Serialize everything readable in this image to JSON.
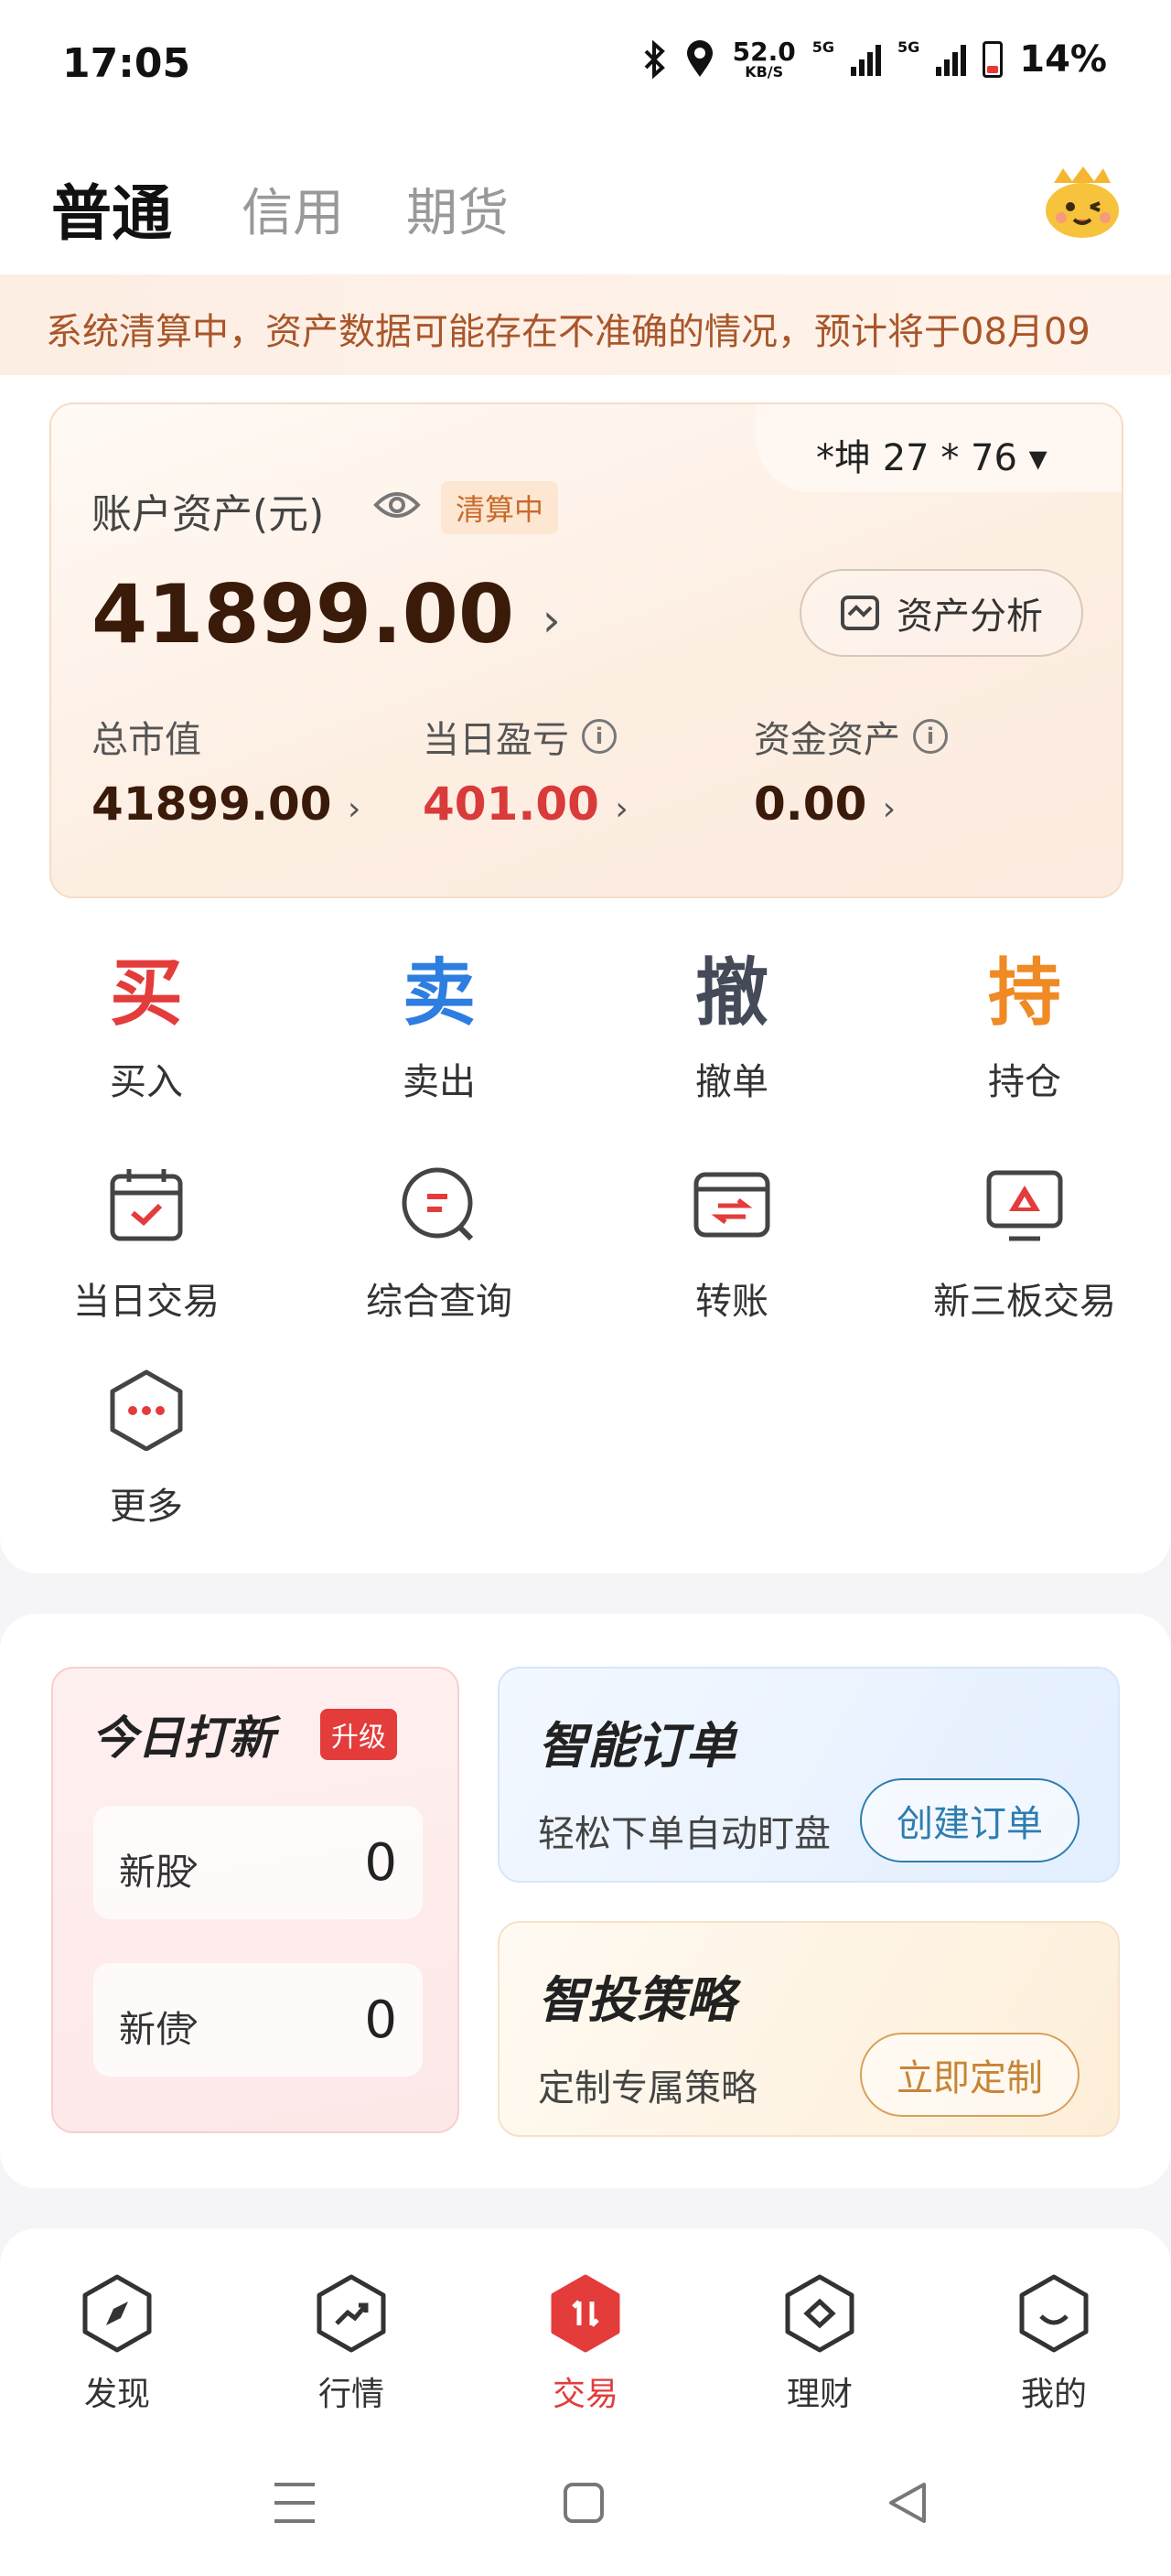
{
  "status_bar": {
    "time": "17:05",
    "net_speed": "52.0",
    "net_unit": "KB/S",
    "gen1": "5G",
    "gen2": "5G",
    "battery": "14%"
  },
  "top_tabs": [
    "普通",
    "信用",
    "期货"
  ],
  "ticker_text": "系统清算中，资产数据可能存在不准确的情况，预计将于08月09",
  "account": {
    "selector": "*坤 27 * 76 ▾",
    "label": "账户资产(元)",
    "clearing_badge": "清算中",
    "total": "41899.00",
    "analysis_button": "资产分析",
    "metrics": [
      {
        "label": "总市值",
        "value": "41899.00"
      },
      {
        "label": "当日盈亏",
        "value": "401.00"
      },
      {
        "label": "资金资产",
        "value": "0.00"
      }
    ]
  },
  "quick_actions": [
    {
      "glyph": "买",
      "label": "买入",
      "color": "#e43b3b"
    },
    {
      "glyph": "卖",
      "label": "卖出",
      "color": "#2e7de0"
    },
    {
      "glyph": "撤",
      "label": "撤单",
      "color": "#444a57"
    },
    {
      "glyph": "持",
      "label": "持仓",
      "color": "#f08a24"
    }
  ],
  "tools": [
    {
      "label": "当日交易",
      "icon": "calendar-check-icon"
    },
    {
      "label": "综合查询",
      "icon": "search-query-icon"
    },
    {
      "label": "转账",
      "icon": "transfer-icon"
    },
    {
      "label": "新三板交易",
      "icon": "monitor-icon"
    },
    {
      "label": "更多",
      "icon": "more-icon"
    }
  ],
  "promos": {
    "new_stock": {
      "title": "今日打新",
      "badge": "升级",
      "rows": [
        {
          "label": "新股",
          "value": "0"
        },
        {
          "label": "新债",
          "value": "0"
        }
      ]
    },
    "smart_order": {
      "title": "智能订单",
      "desc": "轻松下单自动盯盘",
      "button": "创建订单"
    },
    "smart_strategy": {
      "title": "智投策略",
      "desc": "定制专属策略",
      "button": "立即定制"
    }
  },
  "bottom_nav": [
    {
      "label": "发现",
      "icon": "compass-icon"
    },
    {
      "label": "行情",
      "icon": "trend-icon"
    },
    {
      "label": "交易",
      "icon": "trade-icon",
      "active": true
    },
    {
      "label": "理财",
      "icon": "diamond-icon"
    },
    {
      "label": "我的",
      "icon": "profile-icon"
    }
  ],
  "colors": {
    "accent_red": "#e43b3b",
    "accent_blue": "#2e7de0",
    "accent_orange": "#f08a24"
  }
}
